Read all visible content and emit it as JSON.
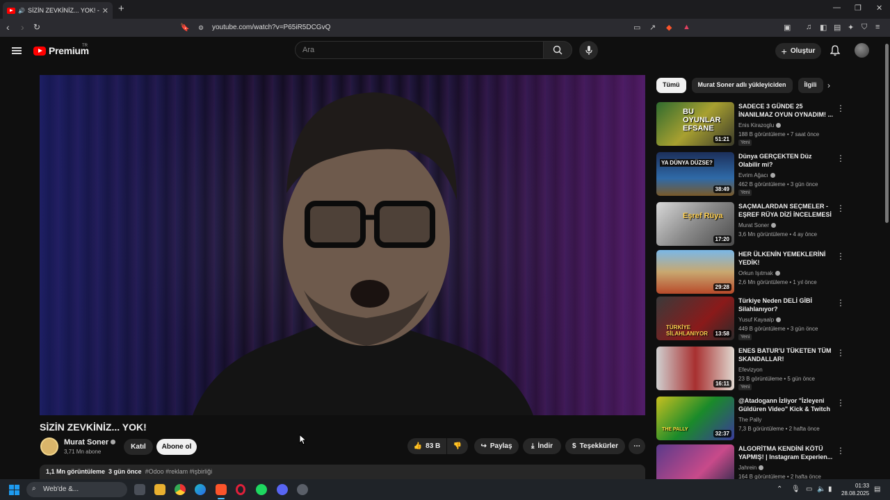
{
  "browser": {
    "tab_title": "SİZİN ZEVKİNİZ... YOK! - YouTube",
    "url": "youtube.com/watch?v=P65iR5DCGvQ"
  },
  "header": {
    "logo": "Premium",
    "region": "TR",
    "search_placeholder": "Ara",
    "create_label": "Oluştur"
  },
  "video": {
    "title": "SİZİN ZEVKİNİZ... YOK!",
    "channel": "Murat Soner",
    "subscribers": "3,71 Mn abone",
    "join_label": "Katıl",
    "subscribe_label": "Abone ol",
    "likes": "83 B",
    "share_label": "Paylaş",
    "download_label": "İndir",
    "thanks_label": "Teşekkürler",
    "views": "1,1 Mn görüntüleme",
    "date": "3 gün önce",
    "tags": "#Odoo #reklam #işbirliği"
  },
  "sidebar": {
    "chips": [
      "Tümü",
      "Murat Soner adlı yükleyiciden",
      "İlgili"
    ],
    "recommendations": [
      {
        "title": "SADECE 3 GÜNDE 25 İNANILMAZ OYUN OYNADIM! ...",
        "channel": "Enis Kirazoglu",
        "meta": "188 B görüntüleme • 7 saat önce",
        "badge": "Yeni",
        "duration": "51:21",
        "thumb_text": "BU OYUNLAR EFSANE"
      },
      {
        "title": "Dünya GERÇEKTEN Düz Olabilir mi?",
        "channel": "Evrim Ağacı",
        "meta": "462 B görüntüleme • 3 gün önce",
        "badge": "Yeni",
        "duration": "38:49",
        "thumb_text": "YA DÜNYA DÜZSE?"
      },
      {
        "title": "SAÇMALARDAN SEÇMELER - EŞREF RÜYA DİZİ İNCELEMESİ",
        "channel": "Murat Soner",
        "meta": "3,6 Mn görüntüleme • 4 ay önce",
        "badge": "",
        "duration": "17:20",
        "thumb_text": "Eşref Rüya"
      },
      {
        "title": "HER ÜLKENİN YEMEKLERİNİ YEDİK!",
        "channel": "Orkun Işıtmak",
        "meta": "2,6 Mn görüntüleme • 1 yıl önce",
        "badge": "",
        "duration": "29:28",
        "thumb_text": ""
      },
      {
        "title": "Türkiye Neden DELİ GİBİ Silahlanıyor?",
        "channel": "Yusuf Kayaalp",
        "meta": "449 B görüntüleme • 3 gün önce",
        "badge": "Yeni",
        "duration": "13:58",
        "thumb_text": "TÜRKİYE SİLAHLANIYOR"
      },
      {
        "title": "ENES BATUR'U TÜKETEN TÜM SKANDALLAR!",
        "channel": "Efevizyon",
        "meta": "23 B görüntüleme • 5 gün önce",
        "badge": "Yeni",
        "duration": "16:11",
        "thumb_text": ""
      },
      {
        "title": "@Atadogann İzliyor \"İzleyeni Güldüren Video\" Kick & Twitch ...",
        "channel": "The Pally",
        "meta": "7,3 B görüntüleme • 2 hafta önce",
        "badge": "",
        "duration": "32:37",
        "thumb_text": "THE PALLY"
      },
      {
        "title": "ALGORİTMA KENDİNİ KÖTÜ YAPMIŞ! | Instagram Experien...",
        "channel": "Jahrein",
        "meta": "164 B görüntüleme • 2 hafta önce",
        "badge": "",
        "duration": "",
        "thumb_text": ""
      }
    ]
  },
  "taskbar": {
    "search_label": "Web'de &...",
    "time": "01:33",
    "date": "28.08.2025"
  }
}
